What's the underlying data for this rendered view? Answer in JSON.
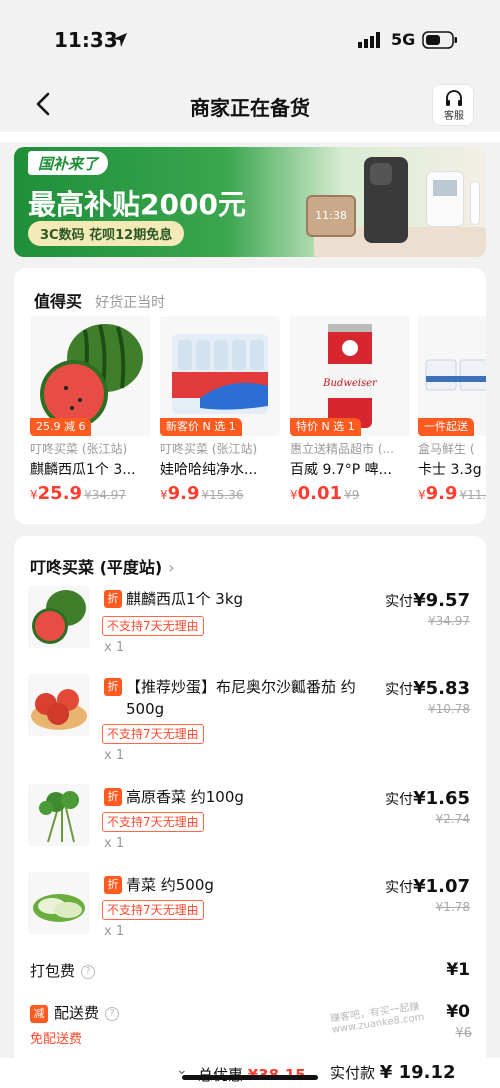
{
  "status": {
    "time": "11:33",
    "network": "5G"
  },
  "nav": {
    "title": "商家正在备货",
    "service_label": "客服"
  },
  "banner": {
    "logo": "国补来了",
    "headline": "最高补贴2000元",
    "sub": "3C数码 花呗12期免息",
    "device_screen": "11:38"
  },
  "deals": {
    "title": "值得买",
    "subtitle": "好货正当时",
    "items": [
      {
        "tag": "25.9 减 6",
        "store": "叮咚买菜 (张江站)",
        "name": "麒麟西瓜1个 3...",
        "currency": "¥",
        "price": "25.9",
        "orig": "¥34.97"
      },
      {
        "tag": "新客价 N 选 1",
        "store": "叮咚买菜 (张江站)",
        "name": "娃哈哈纯净水...",
        "currency": "¥",
        "price": "9.9",
        "orig": "¥15.36"
      },
      {
        "tag": "特价 N 选 1",
        "store": "惠立送精品超市 (...",
        "name": "百威 9.7°P 啤...",
        "currency": "¥",
        "price": "0.01",
        "orig": "¥9"
      },
      {
        "tag": "一件起送",
        "store": "盒马鲜生 (",
        "name": "卡士 3.3g",
        "currency": "¥",
        "price": "9.9",
        "orig": "¥11."
      }
    ]
  },
  "order": {
    "store_name": "叮咚买菜 (平度站)",
    "discount_badge": "折",
    "no_return_label": "不支持7天无理由",
    "paid_label": "实付",
    "items": [
      {
        "name": "麒麟西瓜1个 3kg",
        "qty": "x 1",
        "paid": "¥9.57",
        "orig": "¥34.97"
      },
      {
        "name": "【推荐炒蛋】布尼奥尔沙瓤番茄 约500g",
        "qty": "x 1",
        "paid": "¥5.83",
        "orig": "¥10.78"
      },
      {
        "name": "高原香菜 约100g",
        "qty": "x 1",
        "paid": "¥1.65",
        "orig": "¥2.74"
      },
      {
        "name": "青菜 约500g",
        "qty": "x 1",
        "paid": "¥1.07",
        "orig": "¥1.78"
      }
    ],
    "packing_fee_label": "打包费",
    "packing_fee": "¥1",
    "delivery_badge": "减",
    "delivery_fee_label": "配送费",
    "delivery_fee": "¥0",
    "delivery_orig": "¥6",
    "free_delivery": "免配送费"
  },
  "summary": {
    "discount_label": "总优惠",
    "discount_value": "¥38.15",
    "total_label": "实付款",
    "total_value": "¥ 19.12"
  },
  "watermark": "赚客吧，有买一起赚 www.zuanke8.com",
  "colors": {
    "accent": "#ff3d2e",
    "tag": "#ff5a1f",
    "banner_green": "#1f8f3a"
  }
}
